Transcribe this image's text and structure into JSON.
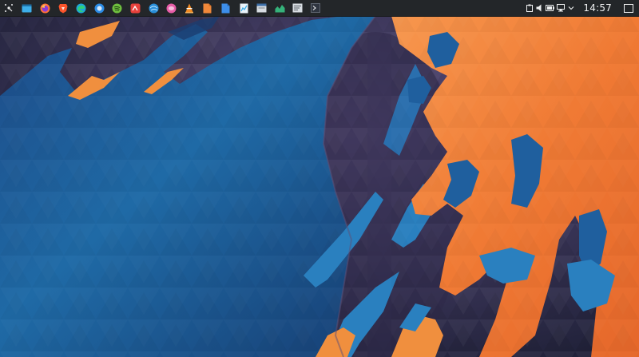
{
  "panel": {
    "launchers": [
      {
        "name": "application-launcher-icon",
        "color": "#eff0f1"
      },
      {
        "name": "dolphin-file-manager-icon",
        "color": "#3daee9"
      },
      {
        "name": "firefox-icon",
        "color": "#ff7139"
      },
      {
        "name": "brave-browser-icon",
        "color": "#fb542b"
      },
      {
        "name": "edge-browser-icon",
        "color": "#1fa7d8"
      },
      {
        "name": "thunderbird-icon",
        "color": "#2c8ce6"
      },
      {
        "name": "spotify-icon",
        "color": "#6fbf3f"
      },
      {
        "name": "kate-editor-icon",
        "color": "#e8413c"
      },
      {
        "name": "browser-globe-icon",
        "color": "#2a8fd8"
      },
      {
        "name": "pink-app-icon",
        "color": "#e75ea8"
      },
      {
        "name": "vlc-icon",
        "color": "#f08a24"
      },
      {
        "name": "document-orange-icon",
        "color": "#f0883a"
      },
      {
        "name": "document-blue-icon",
        "color": "#3d8ee9"
      },
      {
        "name": "okular-chart-icon",
        "color": "#3daee9"
      },
      {
        "name": "presentation-icon",
        "color": "#d8dde2"
      },
      {
        "name": "system-monitor-icon",
        "color": "#35b27a"
      },
      {
        "name": "notes-icon",
        "color": "#d8dde2"
      },
      {
        "name": "terminal-icon",
        "color": "#2f3540"
      }
    ],
    "tray": {
      "icons": [
        "clipboard-icon",
        "volume-icon",
        "battery-icon",
        "network-icon",
        "chevron-down-icon"
      ],
      "clock": "14:57",
      "show_desktop": "show-desktop-icon"
    }
  },
  "wallpaper": {
    "description": "",
    "colors": {
      "background": "#2a2a48",
      "blue": "#1f5f9e",
      "blue_light": "#2a86c4",
      "orange": "#f07a34",
      "orange_light": "#f7a055"
    }
  }
}
